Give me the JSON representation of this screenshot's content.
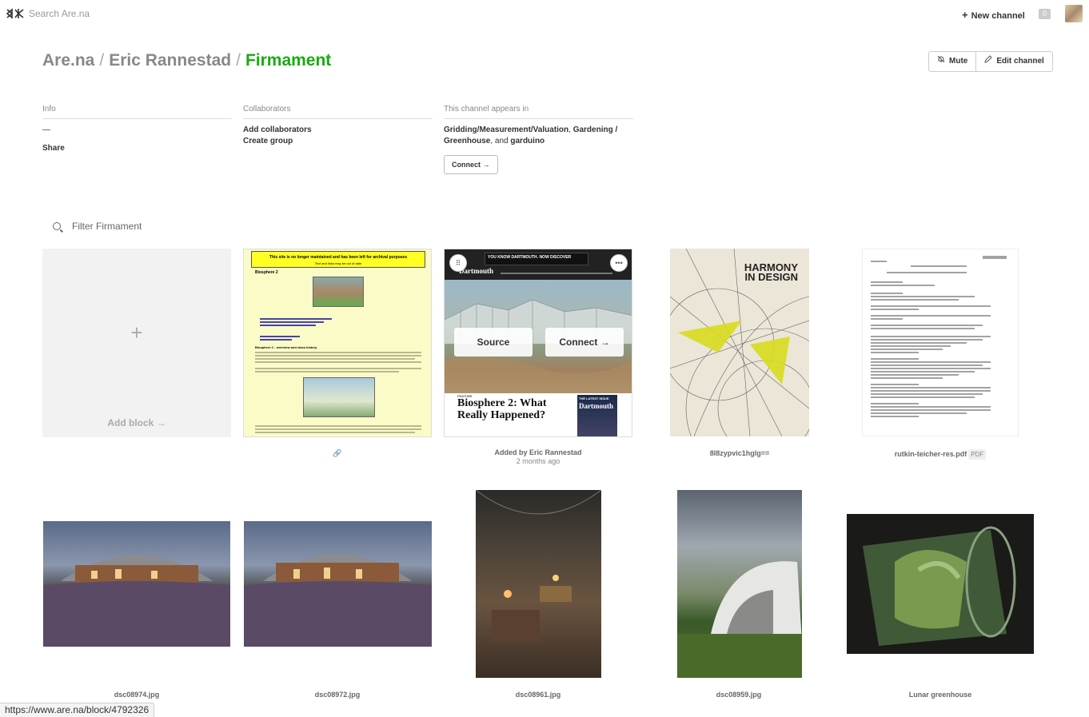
{
  "topbar": {
    "search_placeholder": "Search Are.na",
    "new_channel": "New channel",
    "count_badge": "0"
  },
  "breadcrumb": {
    "root": "Are.na",
    "user": "Eric Rannestad",
    "channel": "Firmament",
    "separator": "/"
  },
  "channel_buttons": {
    "mute": "Mute",
    "edit": "Edit channel"
  },
  "info": {
    "header": "Info",
    "description": "—",
    "share": "Share"
  },
  "collaborators": {
    "header": "Collaborators",
    "add": "Add collaborators",
    "create_group": "Create group"
  },
  "appears_in": {
    "header": "This channel appears in",
    "ch1": "Gridding/Measurement/Valuation",
    "comma": ",",
    "ch2": "Gardening / Greenhouse",
    "and": ", and",
    "ch3": "garduino",
    "connect": "Connect →"
  },
  "filter": {
    "placeholder": "Filter Firmament"
  },
  "blocks": {
    "add_block": {
      "plus": "+",
      "label": "Add block →"
    },
    "b1": {
      "banner": "This site is no longer maintained and has been left for archival purposes",
      "banner_sub": "Text and links may be out of date",
      "heading": "Biosphere 2",
      "heading2": "Biosphere 2 - overview and class history",
      "caption": "🔗"
    },
    "b2": {
      "caption_line1": "Added by Eric Rannestad",
      "caption_line2": "2 months ago",
      "source_btn": "Source",
      "connect_btn": "Connect →",
      "drag_icon": "⠿",
      "more_icon": "•••",
      "ad_text": "YOU KNOW DARTMOUTH. NOW DISCOVER",
      "masthead": "Dartmouth",
      "title": "Biosphere 2: What Really Happened?",
      "kicker": "FEATURE",
      "thumb_label": "THE LATEST ISSUE",
      "thumb_title": "Dartmouth"
    },
    "b3": {
      "title_line1": "HARMONY",
      "title_line2": "IN DESIGN",
      "caption": "8l8zypvic1hglg=="
    },
    "b4": {
      "caption": "rutkin-teicher-res.pdf",
      "tag": "PDF"
    },
    "b5": {
      "caption": "dsc08974.jpg"
    },
    "b6": {
      "caption": "dsc08972.jpg"
    },
    "b7": {
      "caption": "dsc08961.jpg"
    },
    "b8": {
      "caption": "dsc08959.jpg"
    },
    "b9": {
      "caption": "Lunar greenhouse"
    }
  },
  "statusbar": {
    "url": "https://www.are.na/block/4792326"
  }
}
